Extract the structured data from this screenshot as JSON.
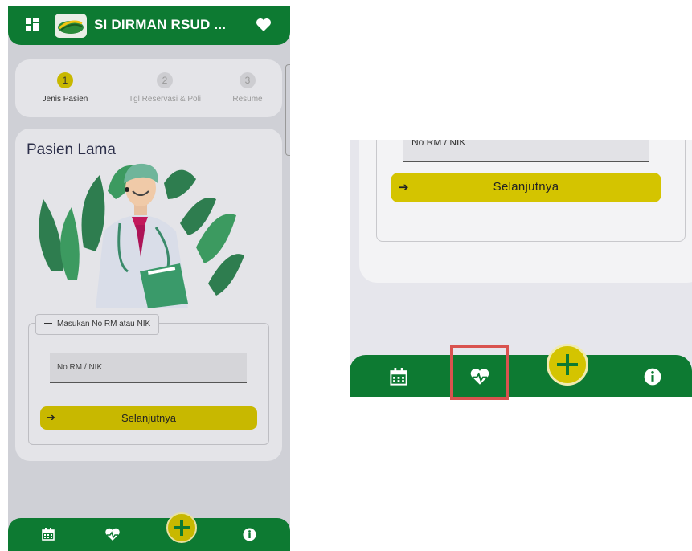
{
  "header": {
    "title": "SI DIRMAN RSUD ...",
    "menu_icon": "grid-icon",
    "right_icon": "heart-icon"
  },
  "stepper": {
    "steps": [
      {
        "number": "1",
        "label": "Jenis Pasien",
        "state": "active"
      },
      {
        "number": "2",
        "label": "Tgl Reservasi & Poli",
        "state": "inactive"
      },
      {
        "number": "3",
        "label": "Resume",
        "state": "inactive"
      }
    ]
  },
  "form": {
    "title": "Pasien Lama",
    "legend_icon": "minus-icon",
    "legend": "Masukan No RM atau NIK",
    "input_placeholder": "No RM / NIK",
    "button_label": "Selanjutnya",
    "button_icon": "arrow-right-icon"
  },
  "bottom_nav": {
    "items": [
      "calendar-icon",
      "heartbeat-icon",
      "plus-icon",
      "info-icon"
    ]
  },
  "zoom_panel": {
    "input_placeholder": "No RM / NIK",
    "button_label": "Selanjutnya",
    "highlighted_icon": "heartbeat-icon"
  },
  "colors": {
    "primary_green": "#0d7a32",
    "accent_yellow": "#c8b800",
    "highlight_red": "#d9534f"
  }
}
